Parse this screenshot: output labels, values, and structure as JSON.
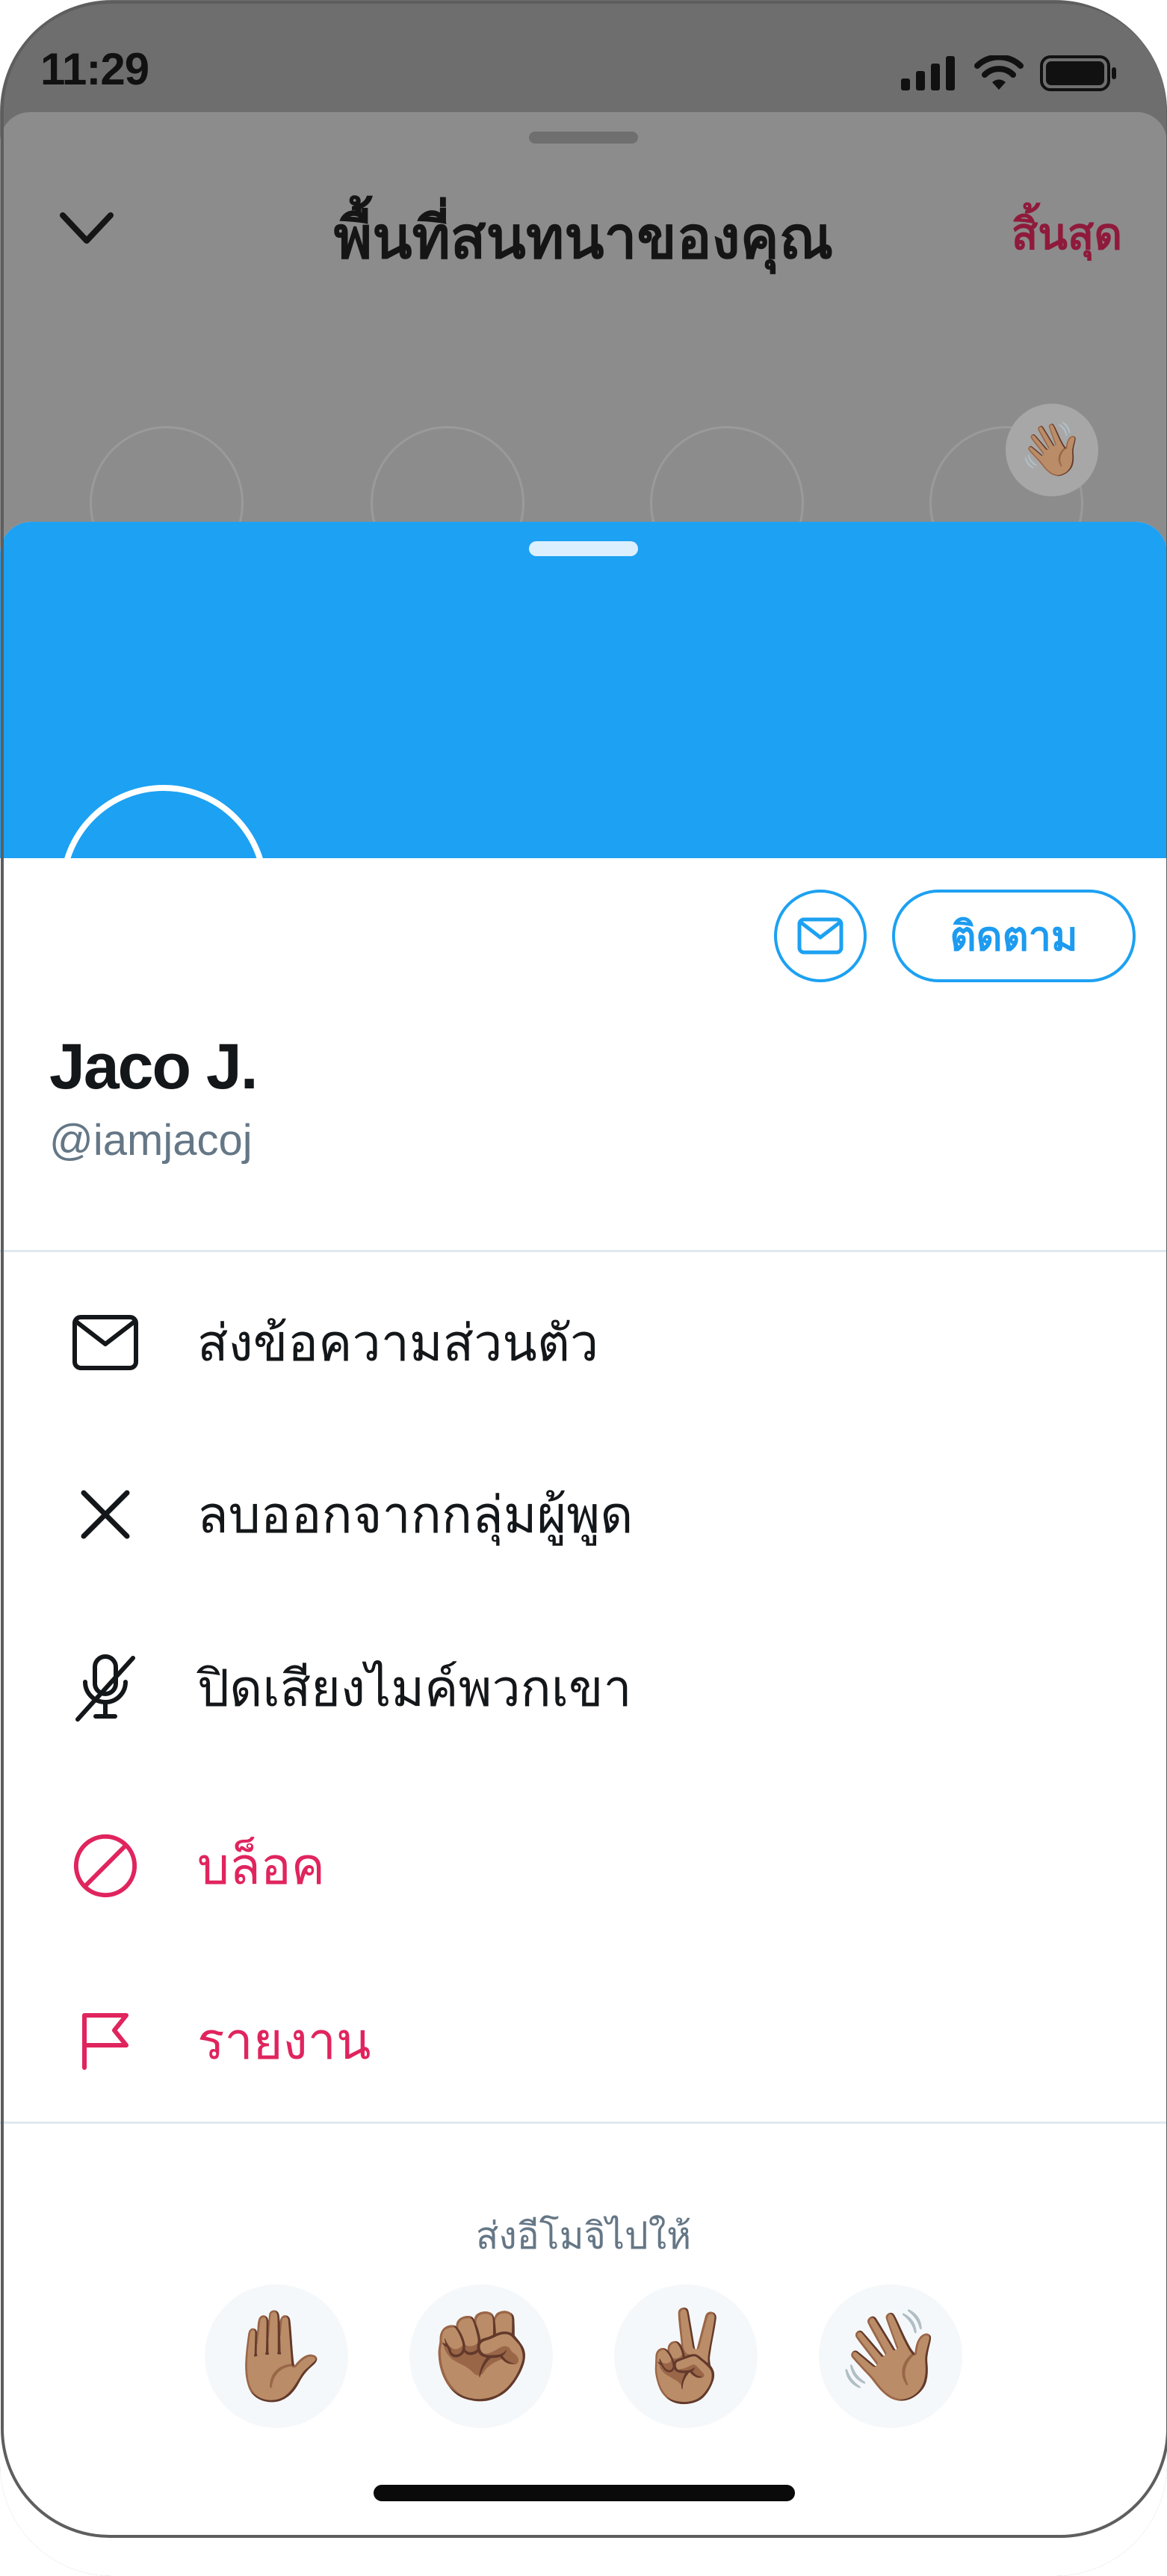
{
  "status_bar": {
    "time": "11:29"
  },
  "background_screen": {
    "title": "พื้นที่สนทนาของคุณ",
    "end_label": "สิ้นสุด",
    "wave_emoji": "👋🏽"
  },
  "profile": {
    "display_name": "Jaco J.",
    "handle": "@iamjacoj",
    "follow_label": "ติดตาม"
  },
  "menu": {
    "items": [
      {
        "label": "ส่งข้อความส่วนตัว",
        "icon": "envelope-icon",
        "color": "#14171a"
      },
      {
        "label": "ลบออกจากกลุ่มผู้พูด",
        "icon": "close-icon",
        "color": "#14171a"
      },
      {
        "label": "ปิดเสียงไมค์พวกเขา",
        "icon": "mic-off-icon",
        "color": "#14171a"
      },
      {
        "label": "บล็อค",
        "icon": "block-icon",
        "color": "#e0245e"
      },
      {
        "label": "รายงาน",
        "icon": "flag-icon",
        "color": "#e0245e"
      }
    ]
  },
  "emoji": {
    "caption": "ส่งอีโมจิไปให้",
    "items": [
      "✋🏽",
      "✊🏽",
      "✌🏽",
      "👋🏽"
    ]
  },
  "colors": {
    "accent": "#1da1f2",
    "danger": "#e0245e",
    "end_label": "#8f1a3b"
  }
}
